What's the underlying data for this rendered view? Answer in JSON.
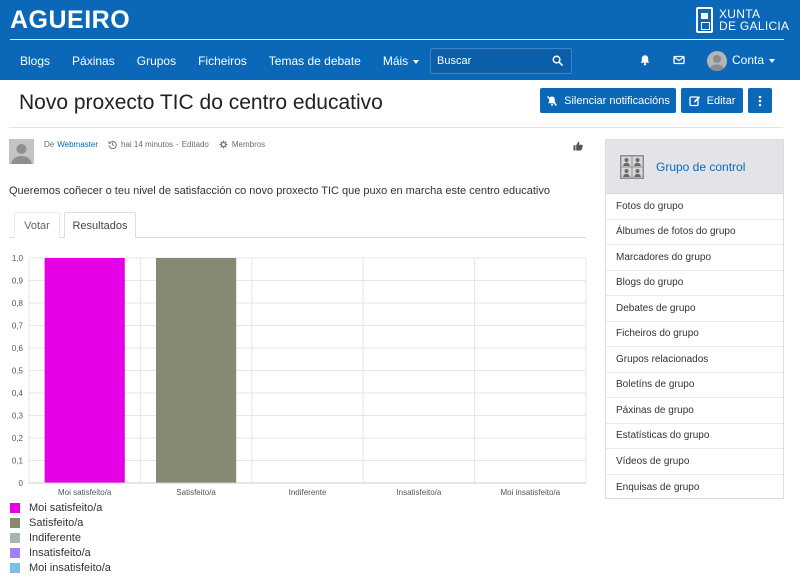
{
  "header": {
    "site_name": "AGUEIRO",
    "brand_line1": "XUNTA",
    "brand_line2": "DE GALICIA",
    "nav": [
      "Blogs",
      "Páxinas",
      "Grupos",
      "Ficheiros",
      "Temas de debate"
    ],
    "more_label": "Máis",
    "search_placeholder": "Buscar",
    "account_label": "Conta",
    "color": "#0b67b7"
  },
  "page": {
    "title": "Novo proxecto TIC do centro educativo",
    "buttons": {
      "mute": "Silenciar notificacións",
      "edit": "Editar"
    }
  },
  "post": {
    "by_prefix": "De",
    "author": "Webmaster",
    "time": "hai 14 minutos",
    "separator": "-",
    "edited": "Editado",
    "access": "Membros",
    "description": "Queremos coñecer o teu nivel de satisfacción co novo proxecto TIC que puxo en marcha este centro educativo"
  },
  "tabs": [
    "Votar",
    "Resultados"
  ],
  "chart_data": {
    "type": "bar",
    "categories": [
      "Moi satisfeito/a",
      "Satisfeito/a",
      "Indiferente",
      "Insatisfeito/a",
      "Moi insatisfeito/a"
    ],
    "values": [
      1.0,
      1.0,
      0,
      0,
      0
    ],
    "colors": [
      "#e500e5",
      "#878a72",
      "#a4b7a9",
      "#a37ff2",
      "#7abfe8"
    ],
    "ylim": [
      0,
      1.0
    ],
    "yticks": [
      "0",
      "0,1",
      "0,2",
      "0,3",
      "0,4",
      "0,5",
      "0,6",
      "0,7",
      "0,8",
      "0,9",
      "1,0"
    ],
    "grid": true,
    "legend_placement": "bottom-left"
  },
  "sidebar": {
    "title": "Grupo de control",
    "items": [
      "Fotos do grupo",
      "Álbumes de fotos do grupo",
      "Marcadores do grupo",
      "Blogs do grupo",
      "Debates de grupo",
      "Ficheiros do grupo",
      "Grupos relacionados",
      "Boletíns de grupo",
      "Páxinas de grupo",
      "Estatísticas do grupo",
      "Vídeos de grupo",
      "Enquisas de grupo"
    ]
  }
}
